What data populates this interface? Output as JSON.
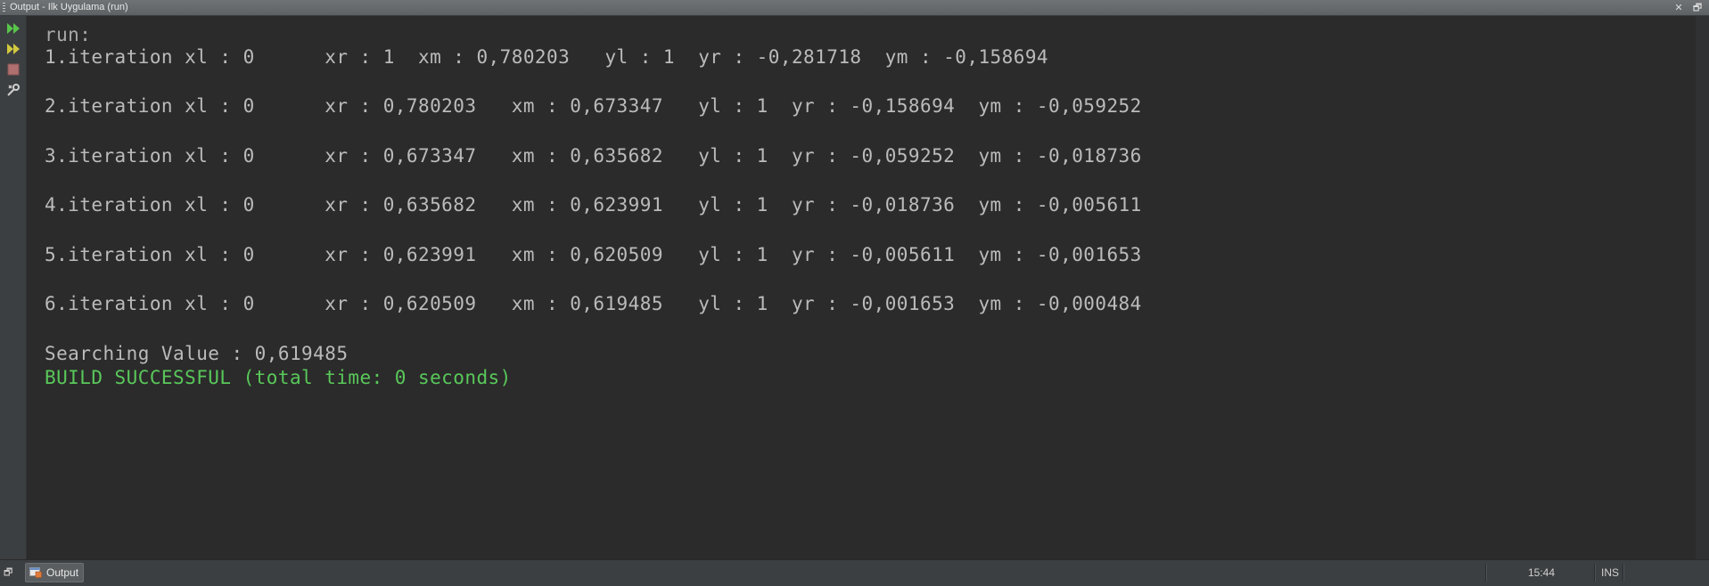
{
  "window": {
    "title": "Output - Ilk Uygulama (run)",
    "close_symbol": "✕",
    "restore_symbol": "🗗"
  },
  "toolbar": {
    "items": [
      {
        "icon": "rerun-icon",
        "color": "#58c64a"
      },
      {
        "icon": "rerun-with-options-icon",
        "color": "#d3c93f"
      },
      {
        "icon": "stop-icon",
        "color": "#b07070"
      },
      {
        "icon": "settings-icon",
        "color": "#d0d0d0"
      }
    ]
  },
  "console": {
    "lines": [
      "run:",
      "1.iteration xl : 0      xr : 1  xm : 0,780203   yl : 1  yr : -0,281718  ym : -0,158694",
      "2.iteration xl : 0      xr : 0,780203   xm : 0,673347   yl : 1  yr : -0,158694  ym : -0,059252",
      "3.iteration xl : 0      xr : 0,673347   xm : 0,635682   yl : 1  yr : -0,059252  ym : -0,018736",
      "4.iteration xl : 0      xr : 0,635682   xm : 0,623991   yl : 1  yr : -0,018736  ym : -0,005611",
      "5.iteration xl : 0      xr : 0,623991   xm : 0,620509   yl : 1  yr : -0,005611  ym : -0,001653",
      "6.iteration xl : 0      xr : 0,620509   xm : 0,619485   yl : 1  yr : -0,001653  ym : -0,000484",
      "Searching Value : 0,619485",
      "BUILD SUCCESSFUL (total time: 0 seconds)"
    ],
    "colors": {
      "text": "#bbbbbb",
      "success": "#59c85a",
      "background": "#2b2b2b"
    }
  },
  "statusbar": {
    "minimize_symbol": "🗗",
    "tab_label": "Output",
    "time": "15:44",
    "mode": "INS"
  }
}
